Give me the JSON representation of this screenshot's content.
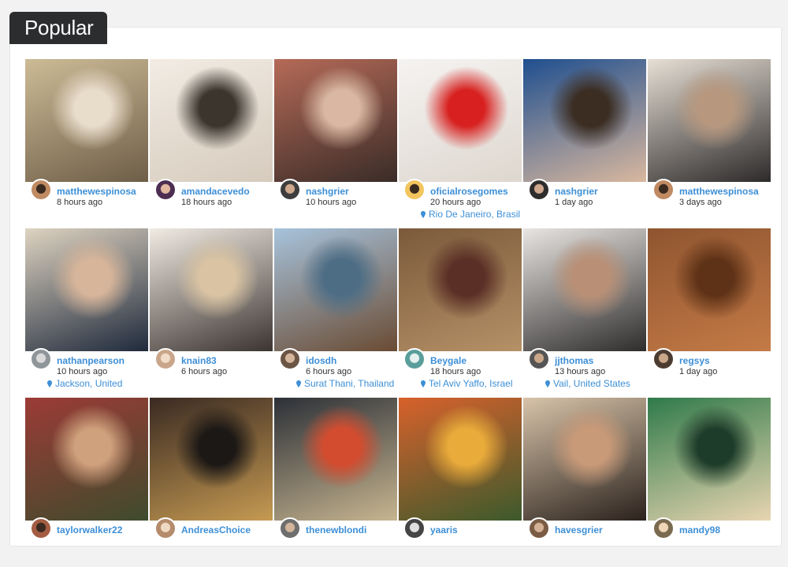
{
  "section_title": "Popular",
  "colors": {
    "link": "#3d8fd6",
    "tab_bg": "#2b2d2f"
  },
  "posts": [
    {
      "username": "matthewespinosa",
      "time": "8 hours ago",
      "location": "",
      "colors": [
        "#cdbb96",
        "#6e5e48",
        "#e8dccb"
      ],
      "avatar": [
        "#c08a62",
        "#3a2a20"
      ]
    },
    {
      "username": "amandacevedo",
      "time": "18 hours ago",
      "location": "",
      "colors": [
        "#f2ece4",
        "#d6cbbd",
        "#3b352e"
      ],
      "avatar": [
        "#4d2e52",
        "#e2b9a0"
      ]
    },
    {
      "username": "nashgrier",
      "time": "10 hours ago",
      "location": "",
      "colors": [
        "#b56a57",
        "#3a2c28",
        "#d9b7a2"
      ],
      "avatar": [
        "#3d3d3d",
        "#cfa88e"
      ]
    },
    {
      "username": "oficialrosegomes",
      "time": "20 hours ago",
      "location": "Rio De Janeiro, Brasil",
      "colors": [
        "#f5f3f1",
        "#ded7cf",
        "#d7201f"
      ],
      "avatar": [
        "#f3c55e",
        "#3a2a20"
      ]
    },
    {
      "username": "nashgrier",
      "time": "1 day ago",
      "location": "",
      "colors": [
        "#1f4f8f",
        "#d9b89f",
        "#3b2d22"
      ],
      "avatar": [
        "#2d2d2d",
        "#cfa88e"
      ]
    },
    {
      "username": "matthewespinosa",
      "time": "3 days ago",
      "location": "",
      "colors": [
        "#e6dfd5",
        "#2d2a2a",
        "#b7987f"
      ],
      "avatar": [
        "#c08a62",
        "#3a2a20"
      ]
    },
    {
      "username": "nathanpearson",
      "time": "10 hours ago",
      "location": "Jackson, United",
      "colors": [
        "#ded3c1",
        "#1f2a3c",
        "#d7b59a"
      ],
      "avatar": [
        "#8e9699",
        "#d9d9d9"
      ]
    },
    {
      "username": "knain83",
      "time": "6 hours ago",
      "location": "",
      "colors": [
        "#f0ebe3",
        "#3c3431",
        "#d9c3a2"
      ],
      "avatar": [
        "#c9a68a",
        "#f1ddc9"
      ]
    },
    {
      "username": "idosdh",
      "time": "6 hours ago",
      "location": "Surat Thani, Thailand",
      "colors": [
        "#a7c3dc",
        "#6a4b33",
        "#4d6d85"
      ],
      "avatar": [
        "#6b5545",
        "#d5b59c"
      ]
    },
    {
      "username": "Beygale",
      "time": "18 hours ago",
      "location": "Tel Aviv Yaffo, Israel",
      "colors": [
        "#7b5a3b",
        "#b59167",
        "#5a2f26"
      ],
      "avatar": [
        "#5a9e9b",
        "#e6f0ef"
      ]
    },
    {
      "username": "jjthomas",
      "time": "13 hours ago",
      "location": "Vail, United States",
      "colors": [
        "#e8e5e2",
        "#2f2d2c",
        "#b99076"
      ],
      "avatar": [
        "#555555",
        "#cba789"
      ]
    },
    {
      "username": "regsys",
      "time": "1 day ago",
      "location": "",
      "colors": [
        "#8f5530",
        "#c47a46",
        "#5e3217"
      ],
      "avatar": [
        "#4b3b30",
        "#cba789"
      ]
    },
    {
      "username": "taylorwalker22",
      "time": "",
      "location": "",
      "colors": [
        "#9c3b36",
        "#3f4b2d",
        "#d0a17d"
      ],
      "avatar": [
        "#a45d43",
        "#3a2a20"
      ]
    },
    {
      "username": "AndreasChoice",
      "time": "",
      "location": "",
      "colors": [
        "#3a2a22",
        "#c59a52",
        "#1c1816"
      ],
      "avatar": [
        "#b48b6b",
        "#f0d9c2"
      ]
    },
    {
      "username": "thenewblondi",
      "time": "",
      "location": "",
      "colors": [
        "#2c3037",
        "#c7b590",
        "#d44c2f"
      ],
      "avatar": [
        "#6e6e6e",
        "#d2b59a"
      ]
    },
    {
      "username": "yaaris",
      "time": "",
      "location": "",
      "colors": [
        "#d8612c",
        "#3c5a2c",
        "#e9ab3a"
      ],
      "avatar": [
        "#454545",
        "#e0e0e0"
      ]
    },
    {
      "username": "havesgrier",
      "time": "",
      "location": "",
      "colors": [
        "#d7c3a9",
        "#2b221d",
        "#c99a78"
      ],
      "avatar": [
        "#7a5b44",
        "#d3b096"
      ]
    },
    {
      "username": "mandy98",
      "time": "",
      "location": "",
      "colors": [
        "#2f7a4a",
        "#e8d5b1",
        "#1e3c2a"
      ],
      "avatar": [
        "#7a6a4f",
        "#eed6b7"
      ]
    }
  ]
}
